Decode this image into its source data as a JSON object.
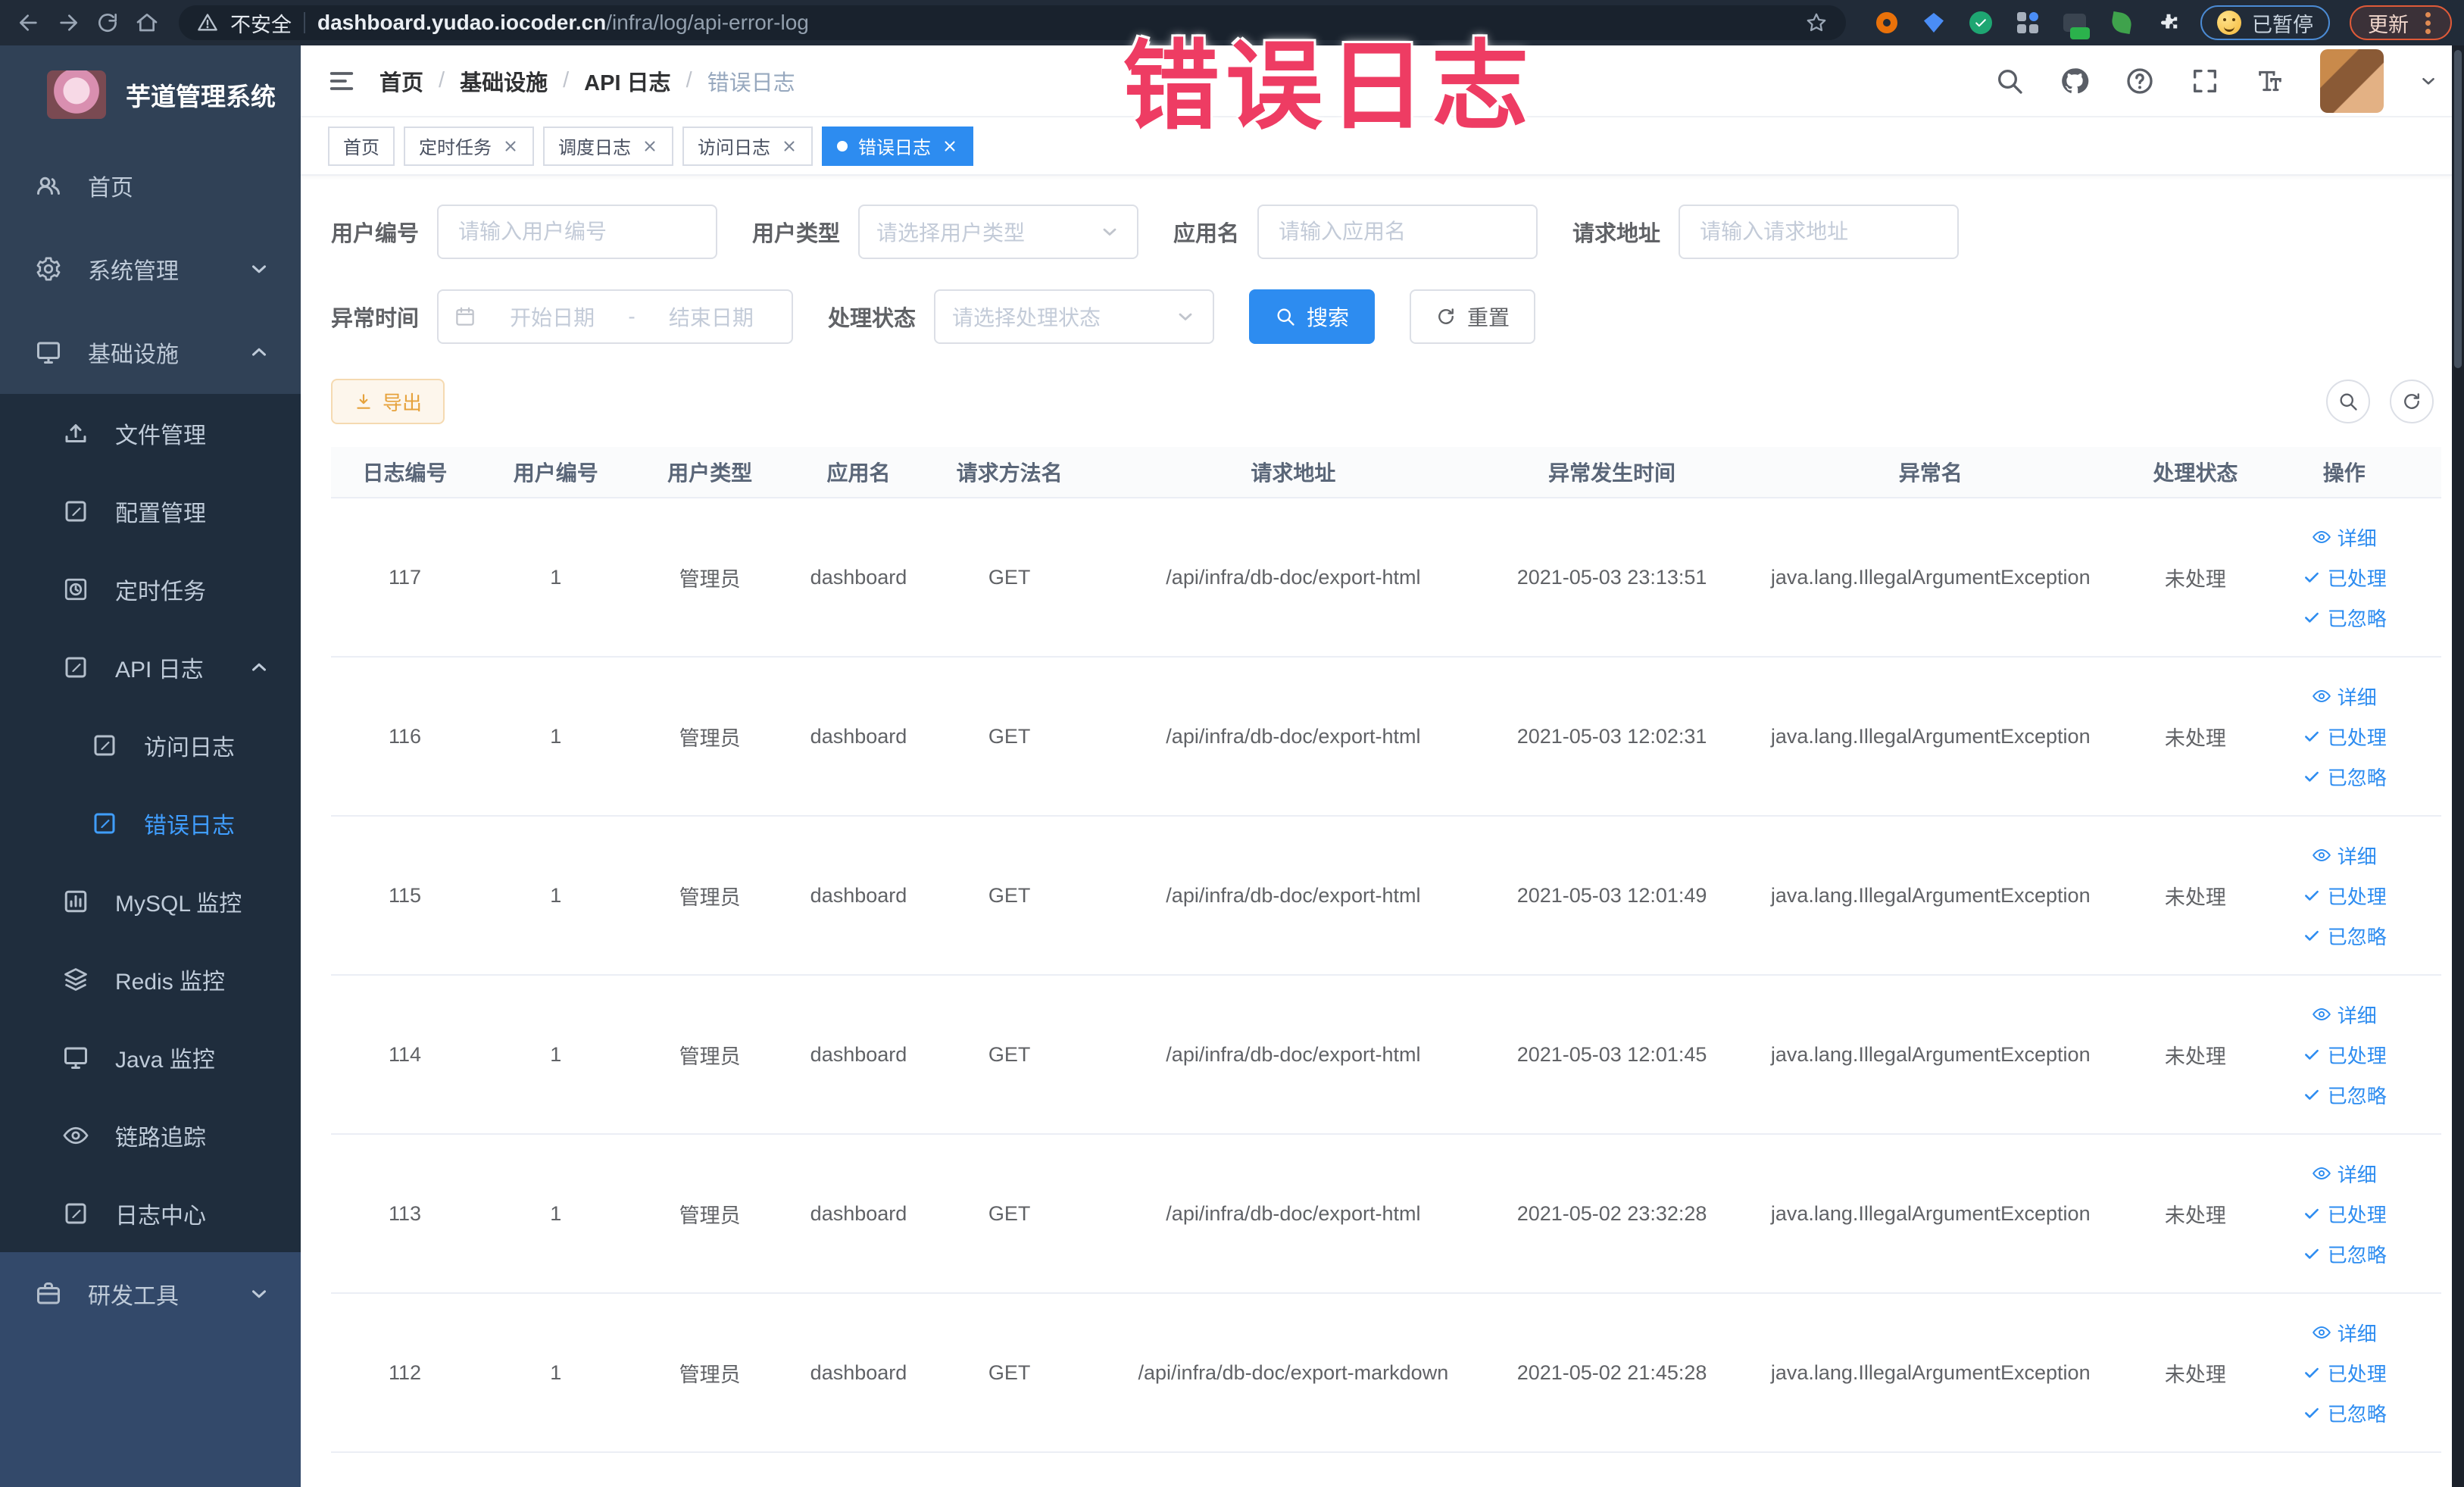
{
  "browser": {
    "security_label": "不安全",
    "url_host": "dashboard.yudao.iocoder.cn",
    "url_path": "/infra/log/api-error-log",
    "paused_label": "已暂停",
    "update_label": "更新"
  },
  "overlay": {
    "title": "错误日志"
  },
  "sidebar": {
    "app_title": "芋道管理系统",
    "labels": {
      "home": "首页",
      "system": "系统管理",
      "infra": "基础设施",
      "file": "文件管理",
      "config": "配置管理",
      "job": "定时任务",
      "apilog": "API 日志",
      "accesslog": "访问日志",
      "errorlog": "错误日志",
      "mysql": "MySQL 监控",
      "redis": "Redis 监控",
      "java": "Java 监控",
      "trace": "链路追踪",
      "logcenter": "日志中心",
      "devtools": "研发工具"
    }
  },
  "header": {
    "breadcrumb": [
      "首页",
      "基础设施",
      "API 日志",
      "错误日志"
    ],
    "separator": "/"
  },
  "tabs": {
    "items": [
      {
        "label": "首页"
      },
      {
        "label": "定时任务"
      },
      {
        "label": "调度日志"
      },
      {
        "label": "访问日志"
      },
      {
        "label": "错误日志"
      }
    ]
  },
  "filters": {
    "user_id": {
      "label": "用户编号",
      "placeholder": "请输入用户编号"
    },
    "user_type": {
      "label": "用户类型",
      "placeholder": "请选择用户类型"
    },
    "app_name": {
      "label": "应用名",
      "placeholder": "请输入应用名"
    },
    "request_url": {
      "label": "请求地址",
      "placeholder": "请输入请求地址"
    },
    "exception_time": {
      "label": "异常时间",
      "start_placeholder": "开始日期",
      "separator": "-",
      "end_placeholder": "结束日期"
    },
    "process_status": {
      "label": "处理状态",
      "placeholder": "请选择处理状态"
    },
    "search_label": "搜索",
    "reset_label": "重置"
  },
  "toolbar": {
    "export_label": "导出"
  },
  "table": {
    "columns": [
      "日志编号",
      "用户编号",
      "用户类型",
      "应用名",
      "请求方法名",
      "请求地址",
      "异常发生时间",
      "异常名",
      "处理状态",
      "操作"
    ],
    "action_labels": [
      "详细",
      "已处理",
      "已忽略"
    ],
    "rows": [
      {
        "id": "117",
        "user_id": "1",
        "user_type": "管理员",
        "app_name": "dashboard",
        "method": "GET",
        "url": "/api/infra/db-doc/export-html",
        "time": "2021-05-03 23:13:51",
        "exception": "java.lang.IllegalArgumentException",
        "status": "未处理"
      },
      {
        "id": "116",
        "user_id": "1",
        "user_type": "管理员",
        "app_name": "dashboard",
        "method": "GET",
        "url": "/api/infra/db-doc/export-html",
        "time": "2021-05-03 12:02:31",
        "exception": "java.lang.IllegalArgumentException",
        "status": "未处理"
      },
      {
        "id": "115",
        "user_id": "1",
        "user_type": "管理员",
        "app_name": "dashboard",
        "method": "GET",
        "url": "/api/infra/db-doc/export-html",
        "time": "2021-05-03 12:01:49",
        "exception": "java.lang.IllegalArgumentException",
        "status": "未处理"
      },
      {
        "id": "114",
        "user_id": "1",
        "user_type": "管理员",
        "app_name": "dashboard",
        "method": "GET",
        "url": "/api/infra/db-doc/export-html",
        "time": "2021-05-03 12:01:45",
        "exception": "java.lang.IllegalArgumentException",
        "status": "未处理"
      },
      {
        "id": "113",
        "user_id": "1",
        "user_type": "管理员",
        "app_name": "dashboard",
        "method": "GET",
        "url": "/api/infra/db-doc/export-html",
        "time": "2021-05-02 23:32:28",
        "exception": "java.lang.IllegalArgumentException",
        "status": "未处理"
      },
      {
        "id": "112",
        "user_id": "1",
        "user_type": "管理员",
        "app_name": "dashboard",
        "method": "GET",
        "url": "/api/infra/db-doc/export-markdown",
        "time": "2021-05-02 21:45:28",
        "exception": "java.lang.IllegalArgumentException",
        "status": "未处理"
      }
    ]
  }
}
